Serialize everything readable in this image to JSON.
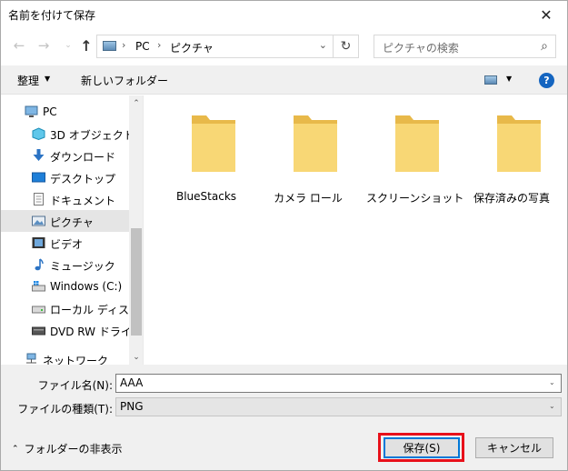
{
  "window": {
    "title": "名前を付けて保存",
    "close_glyph": "✕"
  },
  "nav": {
    "back_glyph": "←",
    "forward_glyph": "→",
    "history_glyph": "⌄",
    "up_glyph": "↑",
    "address": {
      "segments": [
        "PC",
        "ピクチャ"
      ],
      "sep_glyph": "›",
      "dropdown_glyph": "⌄"
    },
    "refresh_glyph": "↻",
    "search": {
      "placeholder": "ピクチャの検索",
      "icon_glyph": "⌕"
    }
  },
  "toolbar": {
    "organize": "整理",
    "caret_glyph": "▼",
    "new_folder": "新しいフォルダー",
    "help_glyph": "?"
  },
  "sidebar": {
    "items": [
      {
        "label": "PC",
        "icon": "pc-icon"
      },
      {
        "label": "3D オブジェクト",
        "icon": "3d-objects-icon"
      },
      {
        "label": "ダウンロード",
        "icon": "download-icon"
      },
      {
        "label": "デスクトップ",
        "icon": "desktop-icon"
      },
      {
        "label": "ドキュメント",
        "icon": "documents-icon"
      },
      {
        "label": "ピクチャ",
        "icon": "pictures-icon",
        "selected": true
      },
      {
        "label": "ビデオ",
        "icon": "videos-icon"
      },
      {
        "label": "ミュージック",
        "icon": "music-icon"
      },
      {
        "label": "Windows (C:)",
        "icon": "drive-icon"
      },
      {
        "label": "ローカル ディスク (D",
        "icon": "drive-icon"
      },
      {
        "label": "DVD RW ドライブ (",
        "icon": "dvd-drive-icon"
      },
      {
        "label": "ネットワーク",
        "icon": "network-icon"
      }
    ],
    "scroll_up_glyph": "⌃",
    "scroll_down_glyph": "⌄"
  },
  "folders": [
    {
      "name": "BlueStacks"
    },
    {
      "name": "カメラ ロール"
    },
    {
      "name": "スクリーンショット"
    },
    {
      "name": "保存済みの写真"
    }
  ],
  "form": {
    "filename_label": "ファイル名(N):",
    "filename_value": "AAA",
    "filetype_label": "ファイルの種類(T):",
    "filetype_value": "PNG",
    "caret_glyph": "⌄"
  },
  "footer": {
    "hide_folders": "フォルダーの非表示",
    "hide_caret_glyph": "⌃",
    "save": "保存(S)",
    "cancel": "キャンセル"
  },
  "colors": {
    "highlight_border": "#e8101a",
    "folder": "#f8d775",
    "accent": "#0078d7"
  }
}
